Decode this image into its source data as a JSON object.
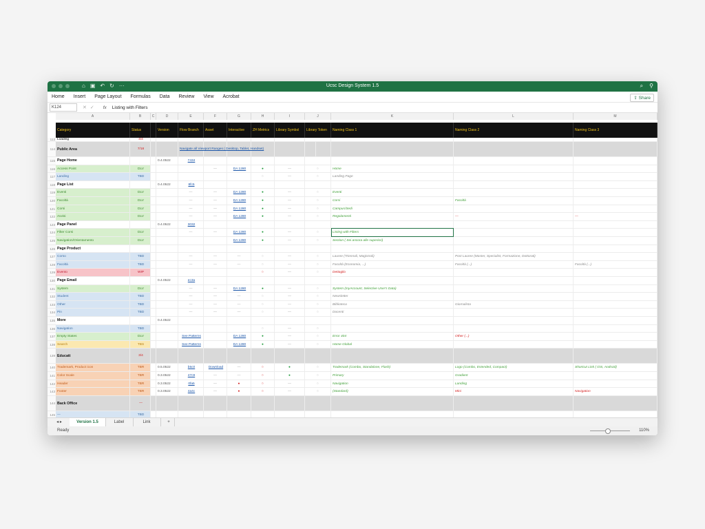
{
  "window": {
    "title": "Ucsc Design System 1.5"
  },
  "menu": [
    "Home",
    "Insert",
    "Page Layout",
    "Formulas",
    "Data",
    "Review",
    "View",
    "Acrobat"
  ],
  "share_label": "Share",
  "formula": {
    "cell": "K124",
    "fx": "fx",
    "content": "Listing with Filters"
  },
  "columns": {
    "letters": [
      "A",
      "B",
      "C",
      "D",
      "E",
      "F",
      "G",
      "H",
      "I",
      "J",
      "K",
      "L",
      "M"
    ],
    "headers": [
      "Category",
      "Status",
      "",
      "Version",
      "Flow Branch",
      "Asset",
      "Interactive",
      "ZH Metrics",
      "Library Symbol",
      "Library Token",
      "Naming Class 1",
      "Naming Class 2",
      "Naming Class 3"
    ]
  },
  "rows": [
    {
      "n": "113",
      "a": "Loading",
      "b": "4/4",
      "type": "cut"
    },
    {
      "n": "114",
      "a": "Public Area",
      "b": "7/18",
      "type": "section",
      "link": "Navigate all Viewport Ranges ( Desktop, Tablet, Handset)"
    },
    {
      "n": "115",
      "a": "Page Home",
      "type": "group",
      "d": "0.4.0522",
      "e": "7434"
    },
    {
      "n": "116",
      "a": "Access Point",
      "b": "DLV",
      "f": "—",
      "g": "DA 1280",
      "h": "green",
      "i": "—",
      "j": "—",
      "k": "Home",
      "kc": "grn"
    },
    {
      "n": "117",
      "a": "Landing",
      "b": "TBD",
      "h": "grey",
      "i": "—",
      "j": "—",
      "k": "Landing Page",
      "kc": "gry"
    },
    {
      "n": "118",
      "a": "Page List",
      "type": "group",
      "d": "0.4.0522",
      "e": "8fc5"
    },
    {
      "n": "119",
      "a": "Eventi",
      "b": "DLV",
      "e": "—",
      "f": "—",
      "g": "DA 1280",
      "h": "green",
      "i": "—",
      "j": "—",
      "k": "Eventi",
      "kc": "grn"
    },
    {
      "n": "120",
      "a": "Facoltà",
      "b": "DLV",
      "e": "—",
      "f": "—",
      "g": "DA 1280",
      "h": "green",
      "i": "—",
      "j": "—",
      "k": "Corsi",
      "kc": "grn",
      "l": "Facoltà",
      "lc": "grn"
    },
    {
      "n": "121",
      "a": "Corsi",
      "b": "DLV",
      "e": "—",
      "f": "—",
      "g": "DA 1280",
      "h": "green",
      "i": "—",
      "j": "—",
      "k": "Campus/Sedi",
      "kc": "grn"
    },
    {
      "n": "122",
      "a": "Avvisi",
      "b": "DLV",
      "e": "—",
      "f": "—",
      "g": "DA 1280",
      "h": "green",
      "i": "—",
      "j": "—",
      "k": "Regolamenti",
      "kc": "grn",
      "l": "—",
      "lc": "red",
      "m": "—",
      "mc": "red"
    },
    {
      "n": "123",
      "a": "Page Panel",
      "type": "group",
      "d": "0.4.0522",
      "e": "3032"
    },
    {
      "n": "124",
      "a": "Filter Corsi",
      "b": "DLV",
      "e": "—",
      "f": "—",
      "g": "DA 1280",
      "h": "green",
      "i": "—",
      "j": "—",
      "k": "Listing with Filters",
      "kc": "grn"
    },
    {
      "n": "125",
      "a": "Navigation/Orientamento",
      "b": "DLV",
      "g": "DA 1280",
      "h": "green",
      "i": "—",
      "j": "—",
      "k": "Section ( Sei ancora alle superiori)",
      "kc": "grn"
    },
    {
      "n": "126",
      "a": "Page Product",
      "type": "group"
    },
    {
      "n": "127",
      "a": "Corso",
      "b": "TBD",
      "e": "—",
      "f": "—",
      "g": "—",
      "h": "grey",
      "i": "—",
      "j": "—",
      "k": "Lauree (Triennali, Magistrali)",
      "kc": "gry",
      "l": "Post Lauree (Master, Specialist, Formazione, Dottorati)",
      "lc": "gry"
    },
    {
      "n": "128",
      "a": "Facoltà",
      "b": "TBD",
      "e": "—",
      "f": "—",
      "g": "—",
      "h": "grey",
      "i": "—",
      "j": "—",
      "k": "Facoltà (Economia, ...)",
      "kc": "gry",
      "l": "Facoltà (...)",
      "lc": "gry",
      "m": "Facoltà (...)",
      "mc": "gry"
    },
    {
      "n": "129",
      "a": "Evento",
      "b": "WIP",
      "h": "red",
      "i": "—",
      "j": "—",
      "k": "Dettaglio",
      "kc": "red"
    },
    {
      "n": "130",
      "a": "Page Email",
      "type": "group",
      "d": "0.4.0522",
      "e": "ec3a"
    },
    {
      "n": "131",
      "a": "System",
      "b": "DLV",
      "e": "—",
      "f": "—",
      "g": "DA 1280",
      "h": "green",
      "i": "—",
      "j": "—",
      "k": "System (myAccount, Selective User's Data)",
      "kc": "grn"
    },
    {
      "n": "132",
      "a": "Student",
      "b": "TBD",
      "e": "—",
      "f": "—",
      "g": "—",
      "h": "grey",
      "i": "—",
      "j": "—",
      "k": "Newsletter",
      "kc": "gry"
    },
    {
      "n": "133",
      "a": "Other",
      "b": "TBD",
      "e": "—",
      "f": "—",
      "g": "—",
      "h": "grey",
      "i": "—",
      "j": "—",
      "k": "Biblioteca",
      "kc": "gry",
      "l": "Giornalista",
      "lc": "gry"
    },
    {
      "n": "134",
      "a": "Pin",
      "b": "TBD",
      "e": "—",
      "f": "—",
      "g": "—",
      "h": "grey",
      "i": "—",
      "j": "—",
      "k": "Docenti",
      "kc": "gry"
    },
    {
      "n": "135",
      "a": "More",
      "type": "group",
      "d": "0.4.0522"
    },
    {
      "n": "136",
      "a": "Navigation",
      "b": "TBD",
      "h": "grey",
      "i": "—",
      "j": "—"
    },
    {
      "n": "137",
      "a": "Empty States",
      "b": "DLV",
      "e": "See Patterns",
      "g": "DA 1280",
      "h": "green",
      "i": "—",
      "j": "—",
      "k": "Error 404",
      "kc": "grn",
      "l": "Other (...)",
      "lc": "red"
    },
    {
      "n": "138",
      "a": "Search",
      "b": "TBS",
      "e": "See Patterns",
      "g": "DA 1280",
      "h": "green",
      "i": "—",
      "j": "—",
      "k": "Home Global",
      "kc": "grn"
    },
    {
      "n": "139",
      "a": "Educatt",
      "b": "3/4",
      "type": "section"
    },
    {
      "n": "140",
      "a": "Trademark, Product icon",
      "b": "TBR",
      "d": "0.5.0522",
      "e": "b5c0",
      "f": "Download",
      "g": "—",
      "h": "red",
      "i": "green",
      "j": "—",
      "k": "Trademark (Combo, Standalone, Flash)",
      "kc": "grn",
      "l": "Logo (Combo, Estended, Compact)",
      "lc": "grn",
      "m": "Shortcut Link ( iOS, Android)",
      "mc": "grn"
    },
    {
      "n": "141",
      "a": "Color Scale",
      "b": "TBR",
      "d": "0.3.0522",
      "e": "47c9",
      "f": "—",
      "g": "—",
      "h": "red",
      "i": "green",
      "j": "—",
      "k": "Primary",
      "kc": "grn",
      "l": "Gradient",
      "lc": "grn"
    },
    {
      "n": "142",
      "a": "Header",
      "b": "TBR",
      "d": "0.3.0522",
      "e": "0fa5",
      "f": "—",
      "g": "red",
      "h": "red",
      "i": "—",
      "j": "—",
      "k": "Navigation",
      "kc": "grn",
      "l": "Landing",
      "lc": "grn"
    },
    {
      "n": "143",
      "a": "Footer",
      "b": "TBR",
      "d": "0.3.0522",
      "e": "4a4c",
      "f": "—",
      "g": "red",
      "h": "red",
      "i": "—",
      "j": "—",
      "k": "(Standard)",
      "kc": "grn",
      "l": "Mini",
      "lc": "red",
      "m": "Navigation",
      "mc": "red"
    },
    {
      "n": "144",
      "a": "Back Office",
      "b": "—",
      "type": "section"
    },
    {
      "n": "145",
      "a": "—",
      "b": "TBD"
    }
  ],
  "tabs": {
    "items": [
      "Version 1.5",
      "Label",
      "Link"
    ],
    "add": "+"
  },
  "status": {
    "ready": "Ready",
    "zoom": "110%"
  },
  "colors": {
    "accent": "#1f7244",
    "header_bg": "#111111",
    "header_text": "#f2c31a"
  }
}
